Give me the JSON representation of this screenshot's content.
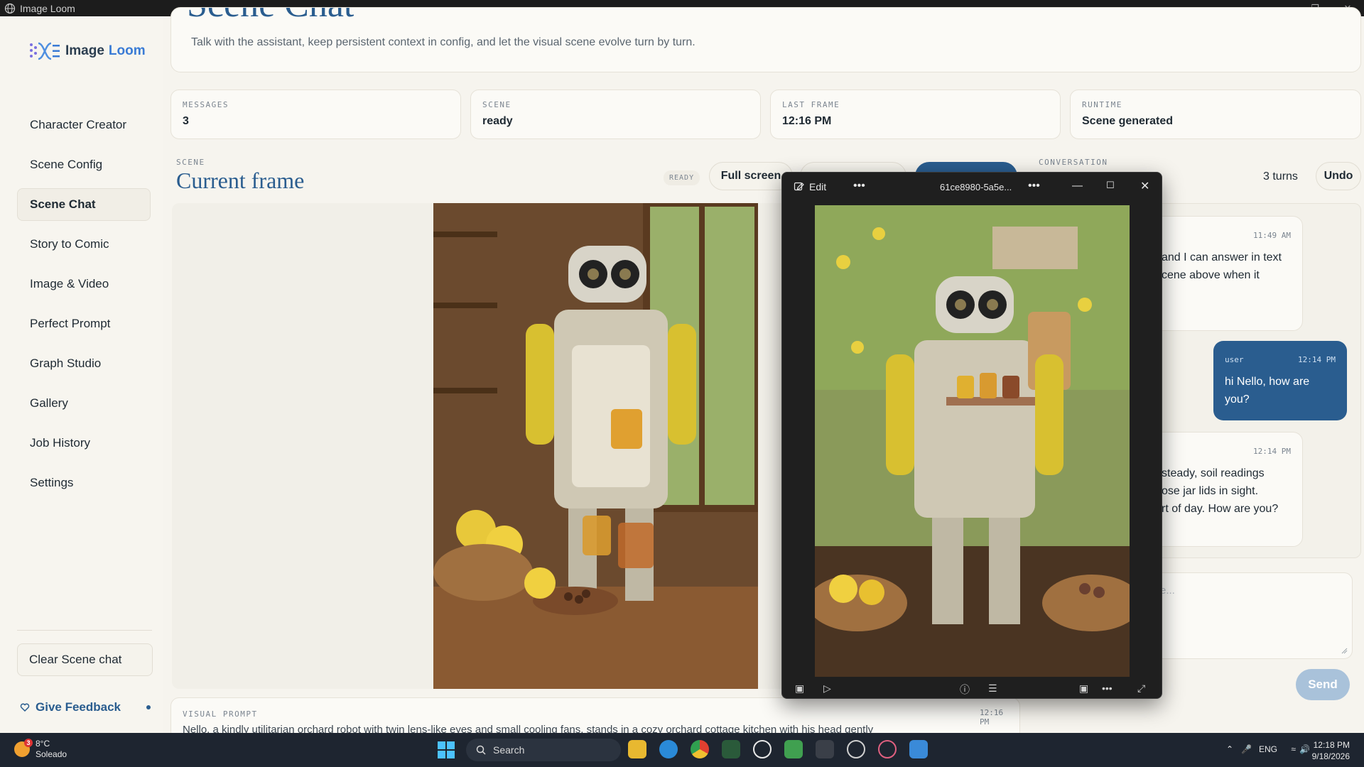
{
  "window": {
    "title": "Image Loom"
  },
  "sidebar": {
    "logo_part1": "Image",
    "logo_part2": "Loom",
    "items": [
      {
        "label": "Character Creator"
      },
      {
        "label": "Scene Config"
      },
      {
        "label": "Scene Chat",
        "active": true
      },
      {
        "label": "Story to Comic"
      },
      {
        "label": "Image & Video"
      },
      {
        "label": "Perfect Prompt"
      },
      {
        "label": "Graph Studio"
      },
      {
        "label": "Gallery"
      },
      {
        "label": "Job History"
      },
      {
        "label": "Settings"
      }
    ],
    "clear_label": "Clear Scene chat",
    "feedback_label": "Give Feedback"
  },
  "header": {
    "title": "Scene Chat",
    "description": "Talk with the assistant, keep persistent context in config, and let the visual scene evolve turn by turn."
  },
  "stats": [
    {
      "label": "MESSAGES",
      "value": "3"
    },
    {
      "label": "SCENE",
      "value": "ready"
    },
    {
      "label": "LAST FRAME",
      "value": "12:16 PM"
    },
    {
      "label": "RUNTIME",
      "value": "Scene generated"
    }
  ],
  "scene": {
    "kicker": "SCENE",
    "title": "Current frame",
    "status": "READY",
    "fullscreen_label": "Full screen"
  },
  "visual_prompt": {
    "label": "VISUAL PROMPT",
    "text": "Nello, a kindly utilitarian orchard robot with twin lens-like eyes and small cooling fans, stands in a cozy orchard cottage kitchen with his head gently",
    "time": "12:16 PM"
  },
  "conversation": {
    "kicker": "CONVERSATION",
    "turns": "3 turns",
    "undo_label": "Undo",
    "messages": [
      {
        "role": "assistant",
        "time": "11:49 AM",
        "text": "and I can answer in text\ncene above when it"
      },
      {
        "role": "user",
        "author": "user",
        "time": "12:14 PM",
        "text": "hi Nello, how are you?"
      },
      {
        "role": "assistant",
        "time": "12:14 PM",
        "text": "steady, soil readings\nose jar lids in sight.\nrt of day. How are you?"
      }
    ],
    "compose_placeholder": "e...",
    "send_label": "Send"
  },
  "viewer": {
    "edit_label": "Edit",
    "filename": "61ce8980-5a5e..."
  },
  "taskbar": {
    "weather_temp": "8°C",
    "weather_desc": "Soleado",
    "weather_badge": "3",
    "search_label": "Search",
    "lang": "ENG",
    "time": "12:18 PM",
    "date": "9/18/2026"
  },
  "colors": {
    "accent": "#2a5d8f",
    "background": "#f6f4ee",
    "taskbar": "#1e2530"
  }
}
